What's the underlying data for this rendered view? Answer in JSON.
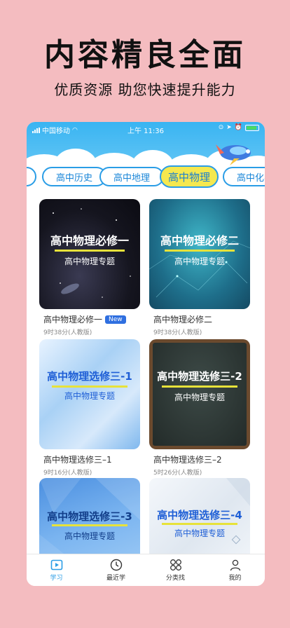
{
  "promo": {
    "title": "内容精良全面",
    "subtitle": "优质资源 助您快速提升能力"
  },
  "status_bar": {
    "carrier": "中国移动",
    "time": "上午 11:36"
  },
  "tabs": [
    {
      "label": ""
    },
    {
      "label": "高中历史"
    },
    {
      "label": "高中地理"
    },
    {
      "label": "高中物理",
      "active": true
    },
    {
      "label": "高中化学"
    }
  ],
  "cards": [
    {
      "thumb_title": "高中物理必修一",
      "thumb_sub": "高中物理专题",
      "title": "高中物理必修一",
      "badge": "New",
      "meta": "9时38分(人教版)"
    },
    {
      "thumb_title": "高中物理必修二",
      "thumb_sub": "高中物理专题",
      "title": "高中物理必修二",
      "badge": "",
      "meta": "9时38分(人教版)"
    },
    {
      "thumb_title": "高中物理选修三-1",
      "thumb_sub": "高中物理专题",
      "title": "高中物理选修三–1",
      "badge": "",
      "meta": "9时16分(人教版)"
    },
    {
      "thumb_title": "高中物理选修三-2",
      "thumb_sub": "高中物理专题",
      "title": "高中物理选修三–2",
      "badge": "",
      "meta": "5时26分(人教版)"
    },
    {
      "thumb_title": "高中物理选修三-3",
      "thumb_sub": "高中物理专题",
      "title": "",
      "badge": "",
      "meta": ""
    },
    {
      "thumb_title": "高中物理选修三-4",
      "thumb_sub": "高中物理专题",
      "title": "",
      "badge": "",
      "meta": ""
    }
  ],
  "tabbar": [
    {
      "label": "学习",
      "icon": "play-square-icon",
      "active": true
    },
    {
      "label": "最近学",
      "icon": "clock-icon"
    },
    {
      "label": "分类找",
      "icon": "grid-icon"
    },
    {
      "label": "我的",
      "icon": "user-icon"
    }
  ],
  "colors": {
    "accent": "#2a9de6",
    "active_tab": "#f5e84f",
    "background": "#f4bcc0"
  }
}
